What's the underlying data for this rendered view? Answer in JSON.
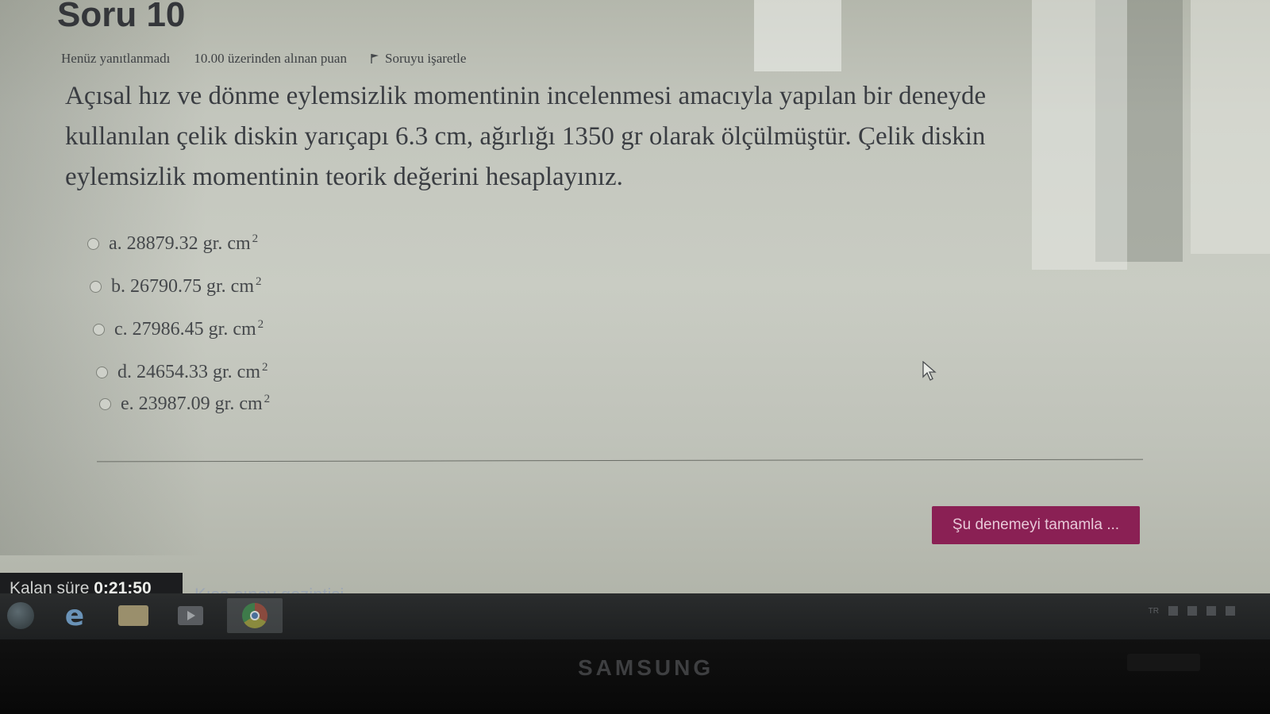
{
  "question": {
    "title": "Soru 10",
    "status": "Henüz yanıtlanmadı",
    "points": "10.00 üzerinden alınan puan",
    "flag_label": "Soruyu işaretle",
    "text": "Açısal hız ve dönme eylemsizlik momentinin incelenmesi amacıyla yapılan bir deneyde kullanılan çelik diskin yarıçapı 6.3 cm, ağırlığı 1350 gr olarak ölçülmüştür. Çelik diskin eylemsizlik momentinin teorik değerini hesaplayınız."
  },
  "answers": [
    {
      "label": "a. 28879.32 gr. cm",
      "sup": "2"
    },
    {
      "label": "b. 26790.75 gr. cm",
      "sup": "2"
    },
    {
      "label": "c. 27986.45 gr. cm",
      "sup": "2"
    },
    {
      "label": "d. 24654.33 gr. cm",
      "sup": "2"
    },
    {
      "label": "e. 23987.09 gr. cm",
      "sup": "2"
    }
  ],
  "finish_button": "Şu denemeyi tamamla ...",
  "timer": {
    "label": "Kalan süre",
    "value": "0:21:50"
  },
  "nav_link": "Kısa sınav gezintisi",
  "taskbar": {
    "items": [
      "start-orb-icon",
      "internet-explorer-icon",
      "folder-icon",
      "media-player-icon",
      "chrome-icon"
    ],
    "tray_lang": "TR"
  },
  "bezel": {
    "brand": "SAMSUNG"
  },
  "colors": {
    "finish_button": "#8a2054",
    "screen_bg": "#c3c6bd",
    "taskbar": "#1e2021"
  }
}
